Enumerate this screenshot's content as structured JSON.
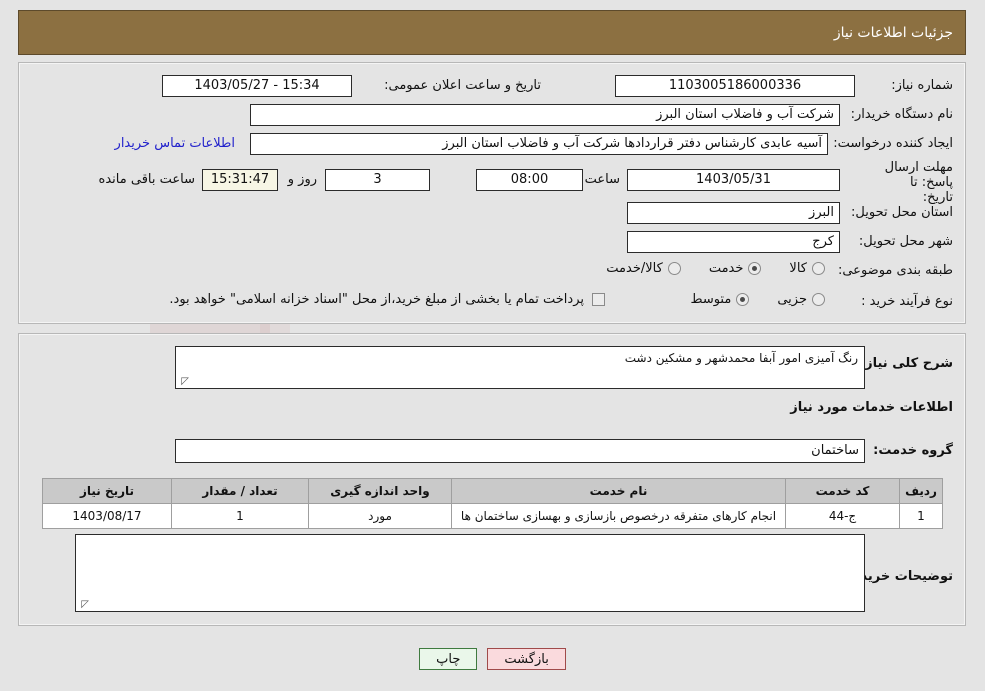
{
  "header": {
    "title": "جزئیات اطلاعات نیاز"
  },
  "watermark": {
    "text": "AriaTender.net"
  },
  "form": {
    "need_number_label": "شماره نیاز:",
    "need_number_value": "1103005186000336",
    "public_announce_label": "تاریخ و ساعت اعلان عمومی:",
    "public_announce_value": "15:34 - 1403/05/27",
    "buyer_org_label": "نام دستگاه خریدار:",
    "buyer_org_value": "شرکت آب و فاضلاب استان البرز",
    "creator_label": "ایجاد کننده درخواست:",
    "creator_value": "آسیه عابدی کارشناس دفتر قراردادها شرکت آب و فاضلاب استان البرز",
    "buyer_contact_link": "اطلاعات تماس خریدار",
    "deadline_label": "مهلت ارسال پاسخ: تا تاریخ:",
    "deadline_label_line1": "مهلت ارسال پاسخ: تا",
    "deadline_label_line2": "تاریخ:",
    "deadline_date": "1403/05/31",
    "deadline_hour_label": "ساعت",
    "deadline_hour": "08:00",
    "remaining_days": "3",
    "remaining_days_unit": "روز و",
    "remaining_timer": "15:31:47",
    "remaining_suffix": "ساعت باقی مانده",
    "province_label": "استان محل تحویل:",
    "province_value": "البرز",
    "city_label": "شهر محل تحویل:",
    "city_value": "کرج",
    "category_label": "طبقه بندی موضوعی:",
    "category_options": [
      {
        "label": "کالا",
        "selected": false
      },
      {
        "label": "خدمت",
        "selected": true
      },
      {
        "label": "کالا/خدمت",
        "selected": false
      }
    ],
    "process_label": "نوع فرآیند خرید :",
    "process_options": [
      {
        "label": "جزیی",
        "selected": false
      },
      {
        "label": "متوسط",
        "selected": true
      }
    ],
    "treasury_checked": false,
    "treasury_note": "پرداخت تمام یا بخشی از مبلغ خرید،از محل \"اسناد خزانه اسلامی\" خواهد بود."
  },
  "middle": {
    "general_desc_label": "شرح کلی نیاز:",
    "general_desc_value": "رنگ آمیزی امور آبفا محمدشهر و مشکین دشت",
    "services_section_title": "اطلاعات خدمات مورد نیاز",
    "service_group_label": "گروه خدمت:",
    "service_group_value": "ساختمان",
    "buyer_notes_label": "توضیحات خریدار:",
    "buyer_notes_value": ""
  },
  "table": {
    "headers": [
      "ردیف",
      "کد خدمت",
      "نام خدمت",
      "واحد اندازه گیری",
      "تعداد / مقدار",
      "تاریخ نیاز"
    ],
    "rows": [
      {
        "index": "1",
        "code": "ج-44",
        "name": "انجام کارهای متفرقه درخصوص بازسازی و بهسازی ساختمان ها",
        "unit": "مورد",
        "qty": "1",
        "date": "1403/08/17"
      }
    ]
  },
  "buttons": {
    "back": "بازگشت",
    "print": "چاپ"
  },
  "colors": {
    "header_bg": "#8c7041",
    "page_bg": "#e4e4e4",
    "link": "#2222cc",
    "timer_bg": "#f7f6e5",
    "back_btn_bg": "#fadadd",
    "print_btn_bg": "#eaf7ea"
  }
}
